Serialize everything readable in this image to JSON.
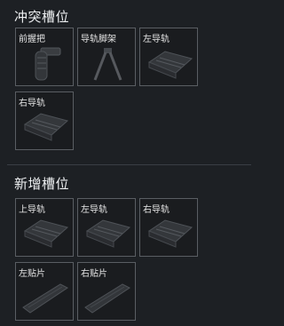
{
  "conflict_section": {
    "title": "冲突槽位",
    "slots": [
      {
        "label": "前握把",
        "icon": "grip-icon"
      },
      {
        "label": "导轨脚架",
        "icon": "bipod-icon"
      },
      {
        "label": "左导轨",
        "icon": "rail-mount-icon"
      },
      {
        "label": "右导轨",
        "icon": "rail-mount-icon"
      }
    ]
  },
  "new_section": {
    "title": "新增槽位",
    "slots": [
      {
        "label": "上导轨",
        "icon": "rail-mount-icon"
      },
      {
        "label": "左导轨",
        "icon": "rail-mount-icon"
      },
      {
        "label": "右导轨",
        "icon": "rail-mount-icon"
      },
      {
        "label": "左贴片",
        "icon": "rail-cover-icon"
      },
      {
        "label": "右贴片",
        "icon": "rail-cover-icon"
      }
    ]
  }
}
